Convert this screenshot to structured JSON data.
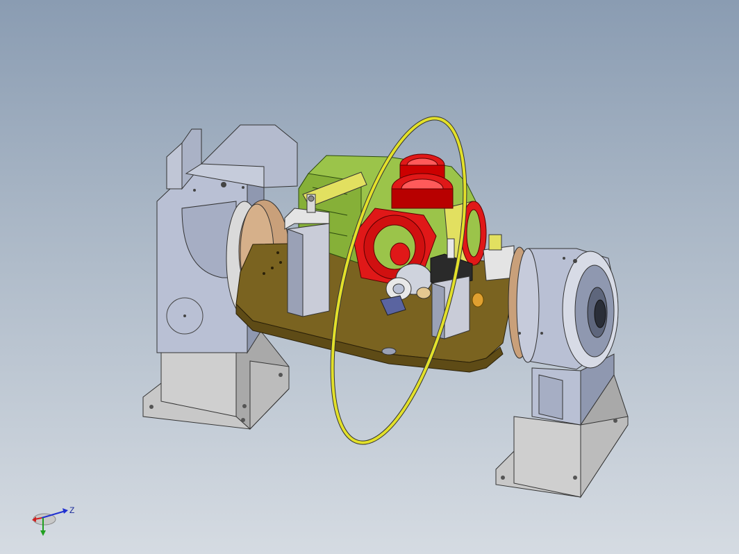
{
  "viewport": {
    "background_top": "#8a9cb2",
    "background_bottom": "#d5dbe2"
  },
  "model": {
    "part_colors": {
      "fixture_steel": "#b9c0d4",
      "base_block": "#c9c9c9",
      "table_plate": "#7a6320",
      "motor_housing": "#9bc44a",
      "red_flange": "#e01818",
      "yellow_ring": "#e2e02a",
      "bronze_disc": "#c9a07a"
    }
  },
  "triad": {
    "x_axis_color": "#d02020",
    "y_axis_color": "#20a020",
    "z_axis_color": "#2030d0",
    "z_label": "Z"
  }
}
